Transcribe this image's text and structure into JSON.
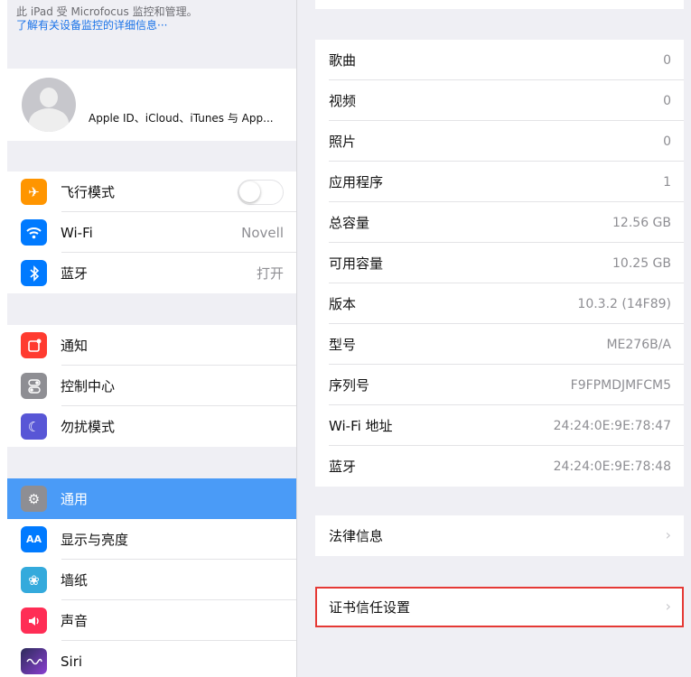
{
  "management": {
    "line1": "此 iPad 受 Microfocus 监控和管理。",
    "line2": "了解有关设备监控的详细信息···"
  },
  "profile": {
    "label": "Apple ID、iCloud、iTunes 与 App..."
  },
  "sidebar": {
    "group1": [
      {
        "label": "飞行模式",
        "icon": "airplane-icon",
        "color": "#FF9500"
      },
      {
        "label": "Wi-Fi",
        "value": "Novell",
        "icon": "wifi-icon",
        "color": "#007AFF"
      },
      {
        "label": "蓝牙",
        "value": "打开",
        "icon": "bluetooth-icon",
        "color": "#007AFF"
      }
    ],
    "group2": [
      {
        "label": "通知",
        "icon": "notifications-icon",
        "color": "#FF3B30"
      },
      {
        "label": "控制中心",
        "icon": "control-center-icon",
        "color": "#8E8E93"
      },
      {
        "label": "勿扰模式",
        "icon": "moon-icon",
        "color": "#5856D6"
      }
    ],
    "group3": [
      {
        "label": "通用",
        "icon": "gear-icon",
        "color": "#8E8E93",
        "selected": true
      },
      {
        "label": "显示与亮度",
        "icon": "display-icon",
        "glyph": "AA",
        "color": "#007AFF"
      },
      {
        "label": "墙纸",
        "icon": "wallpaper-icon",
        "color": "#34AADC"
      },
      {
        "label": "声音",
        "icon": "sound-icon",
        "color": "#FF2D55"
      },
      {
        "label": "Siri",
        "icon": "siri-icon",
        "color": "#2C2C5A"
      }
    ]
  },
  "about": [
    {
      "label": "歌曲",
      "value": "0"
    },
    {
      "label": "视频",
      "value": "0"
    },
    {
      "label": "照片",
      "value": "0"
    },
    {
      "label": "应用程序",
      "value": "1"
    },
    {
      "label": "总容量",
      "value": "12.56 GB"
    },
    {
      "label": "可用容量",
      "value": "10.25 GB"
    },
    {
      "label": "版本",
      "value": "10.3.2 (14F89)"
    },
    {
      "label": "型号",
      "value": "ME276B/A"
    },
    {
      "label": "序列号",
      "value": "F9FPMDJMFCM5"
    },
    {
      "label": "Wi-Fi 地址",
      "value": "24:24:0E:9E:78:47"
    },
    {
      "label": "蓝牙",
      "value": "24:24:0E:9E:78:48"
    }
  ],
  "legal": {
    "label": "法律信息"
  },
  "certificate_trust": {
    "label": "证书信任设置",
    "highlight_color": "#E53935"
  },
  "colors": {
    "selected_row": "#4A9BF7",
    "link": "#1A73E8"
  }
}
